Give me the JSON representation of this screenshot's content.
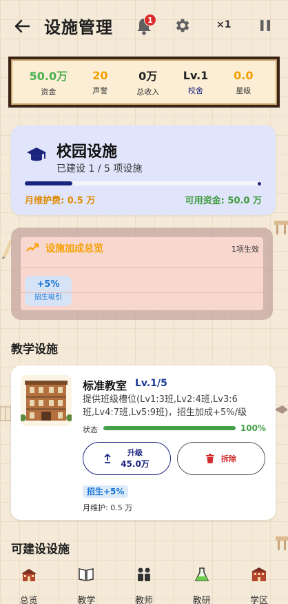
{
  "header": {
    "title": "设施管理",
    "notification_count": "1",
    "speed": "×1"
  },
  "stats": [
    {
      "value": "50.0万",
      "label": "资金",
      "color": "#4caf50"
    },
    {
      "value": "20",
      "label": "声誉",
      "color": "#f0a000"
    },
    {
      "value": "0万",
      "label": "总收入",
      "color": "#222222"
    },
    {
      "value": "Lv.1",
      "label": "校舍",
      "color": "#222222"
    },
    {
      "value": "0.0",
      "label": "星级",
      "color": "#f0a000"
    }
  ],
  "campus": {
    "title": "校园设施",
    "subtitle": "已建设 1 / 5 项设施",
    "built": 1,
    "total": 5,
    "maintenance": "月维护费: 0.5 万",
    "available_funds": "可用资金: 50.0 万"
  },
  "bonus": {
    "title": "设施加成总览",
    "count": "1项生效",
    "chips": [
      {
        "value": "+5%",
        "label": "招生吸引"
      }
    ]
  },
  "sections": {
    "teaching": "教学设施",
    "buildable": "可建设设施"
  },
  "facility": {
    "name": "标准教室",
    "level": "Lv.1/5",
    "description": "提供班级槽位(Lv1:3班,Lv2:4班,Lv3:6班,Lv4:7班,Lv5:9班)，招生加成+5%/级",
    "status_label": "状态",
    "status_percent": "100%",
    "status_value": 1.0,
    "upgrade_label": "升级",
    "upgrade_cost": "45.0万",
    "demolish_label": "拆除",
    "tag": "招生+5%",
    "maintenance": "月维护: 0.5 万"
  },
  "nav": [
    {
      "label": "总览",
      "icon": "school-house-icon"
    },
    {
      "label": "教学",
      "icon": "book-icon"
    },
    {
      "label": "教师",
      "icon": "teachers-icon"
    },
    {
      "label": "教研",
      "icon": "flask-icon"
    },
    {
      "label": "学区",
      "icon": "district-building-icon"
    }
  ],
  "colors": {
    "primary": "#1a237e",
    "success": "#43a047",
    "warning": "#e08a00",
    "danger": "#d32f2f"
  }
}
